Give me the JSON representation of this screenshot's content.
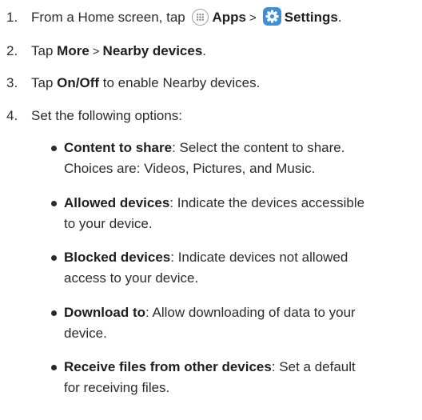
{
  "steps": [
    {
      "number": "1.",
      "prefix": "From a Home screen, tap",
      "apps_label": "Apps",
      "separator": ">",
      "settings_label": "Settings",
      "suffix": "."
    },
    {
      "number": "2.",
      "prefix": "Tap",
      "more_label": "More",
      "separator": ">",
      "nearby_label": "Nearby devices",
      "suffix": "."
    },
    {
      "number": "3.",
      "prefix": "Tap",
      "onoff_label": "On/Off",
      "suffix": "to enable Nearby devices."
    },
    {
      "number": "4.",
      "text": "Set the following options:"
    }
  ],
  "options": [
    {
      "term": "Content to share",
      "line1": ": Select the content to share.",
      "line2": "Choices are: Videos, Pictures, and Music."
    },
    {
      "term": "Allowed devices",
      "line1": ": Indicate the devices accessible",
      "line2": "to your device."
    },
    {
      "term": "Blocked devices",
      "line1": ": Indicate devices not allowed",
      "line2": "access to your device."
    },
    {
      "term": "Download to",
      "line1": ": Allow downloading of data to your",
      "line2": "device."
    },
    {
      "term": "Receive files from other devices",
      "line1": ": Set a default",
      "line2": "for receiving files."
    }
  ],
  "icons": {
    "apps": "apps-grid-icon",
    "settings": "gear-icon"
  },
  "colors": {
    "settings_icon_bg": "#3f8fd2",
    "text": "#2b2b2b"
  }
}
